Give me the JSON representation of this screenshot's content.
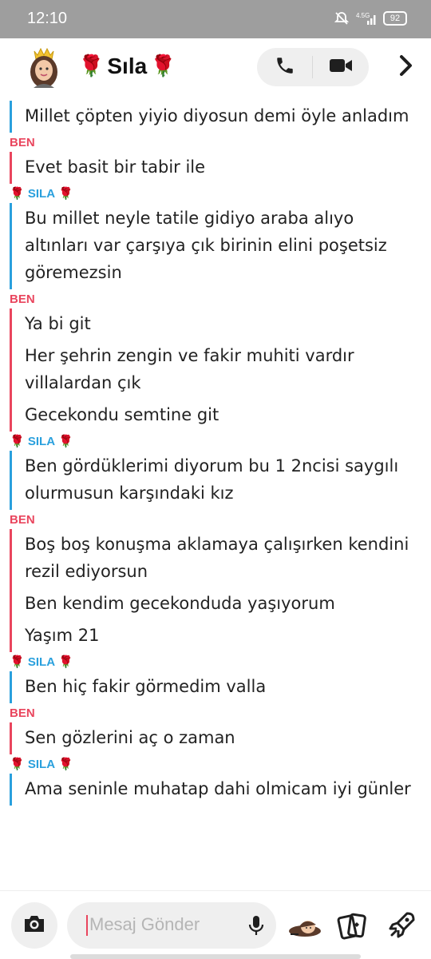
{
  "status_bar": {
    "time": "12:10",
    "network": "4.5G",
    "battery": "92"
  },
  "header": {
    "contact_name": "Sıla",
    "rose": "🌹"
  },
  "chat": {
    "messages": [
      {
        "sender": "SILA",
        "sender_label": "",
        "lines": [
          "Millet çöpten yiyio diyosun demi öyle anladım"
        ]
      },
      {
        "sender": "BEN",
        "sender_label": "BEN",
        "lines": [
          "Evet basit bir tabir ile"
        ]
      },
      {
        "sender": "SILA",
        "sender_label": "SILA",
        "lines": [
          "Bu millet neyle tatile gidiyo araba alıyo altınları var çarşıya çık birinin elini poşetsiz göremezsin"
        ]
      },
      {
        "sender": "BEN",
        "sender_label": "BEN",
        "lines": [
          "Ya bi git",
          "Her şehrin zengin ve fakir muhiti vardır villalardan çık",
          "Gecekondu semtine git"
        ]
      },
      {
        "sender": "SILA",
        "sender_label": "SILA",
        "lines": [
          "Ben gördüklerimi diyorum bu 1 2ncisi saygılı olurmusun karşındaki kız"
        ]
      },
      {
        "sender": "BEN",
        "sender_label": "BEN",
        "lines": [
          "Boş boş konuşma aklamaya çalışırken kendini rezil ediyorsun",
          "Ben kendim gecekonduda yaşıyorum",
          "Yaşım 21"
        ]
      },
      {
        "sender": "SILA",
        "sender_label": "SILA",
        "lines": [
          "Ben hiç fakir görmedim valla"
        ]
      },
      {
        "sender": "BEN",
        "sender_label": "BEN",
        "lines": [
          "Sen gözlerini aç o zaman"
        ]
      },
      {
        "sender": "SILA",
        "sender_label": "SILA",
        "lines": [
          "Ama seninle muhatap dahi olmicam iyi günler"
        ]
      }
    ]
  },
  "composer": {
    "placeholder": "Mesaj Gönder"
  },
  "colors": {
    "ben": "#e9455d",
    "sila": "#2aa0dd"
  }
}
